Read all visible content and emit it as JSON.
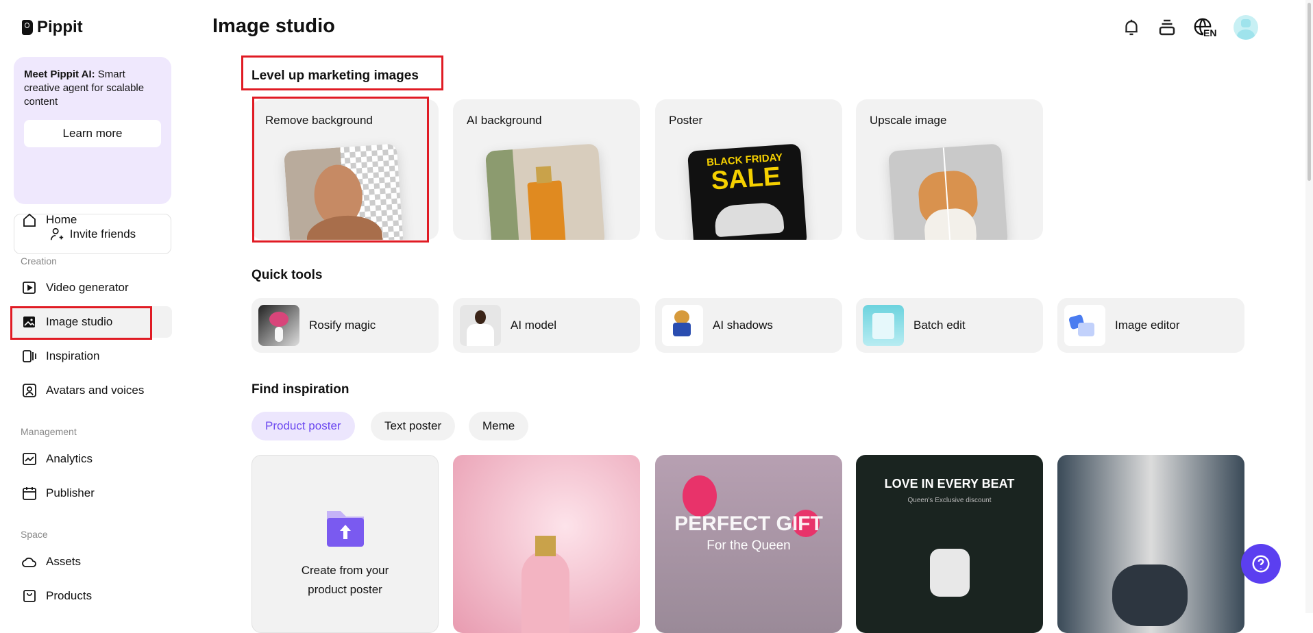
{
  "app": {
    "name": "Pippit"
  },
  "sidebar": {
    "promo": {
      "title": "Meet Pippit AI:",
      "text": " Smart creative agent for scalable content",
      "button": "Learn more"
    },
    "invite": "Invite friends",
    "home": "Home",
    "sections": [
      {
        "label": "Creation",
        "items": [
          "Video generator",
          "Image studio",
          "Inspiration",
          "Avatars and voices"
        ]
      },
      {
        "label": "Management",
        "items": [
          "Analytics",
          "Publisher"
        ]
      },
      {
        "label": "Space",
        "items": [
          "Assets",
          "Products"
        ]
      }
    ]
  },
  "header": {
    "title": "Image studio",
    "lang": "EN"
  },
  "featured": {
    "heading": "Level up marketing images",
    "cards": [
      "Remove background",
      "AI background",
      "Poster",
      "Upscale image"
    ],
    "poster_text": {
      "line1": "BLACK FRIDAY",
      "line2": "SALE"
    }
  },
  "quick": {
    "heading": "Quick tools",
    "items": [
      "Rosify magic",
      "AI model",
      "AI shadows",
      "Batch edit",
      "Image editor"
    ]
  },
  "inspiration": {
    "heading": "Find inspiration",
    "chips": [
      "Product poster",
      "Text poster",
      "Meme"
    ],
    "create_label": "Create from your product poster",
    "posters": {
      "p2": {
        "title": "PERFECT GIFT",
        "sub": "For the Queen"
      },
      "p3": {
        "title": "LOVE IN EVERY BEAT",
        "sub": "Queen's Exclusive discount"
      }
    }
  },
  "colors": {
    "accent": "#5b3ff0",
    "highlight": "#e01b24",
    "promo_bg": "#efe8fd"
  }
}
